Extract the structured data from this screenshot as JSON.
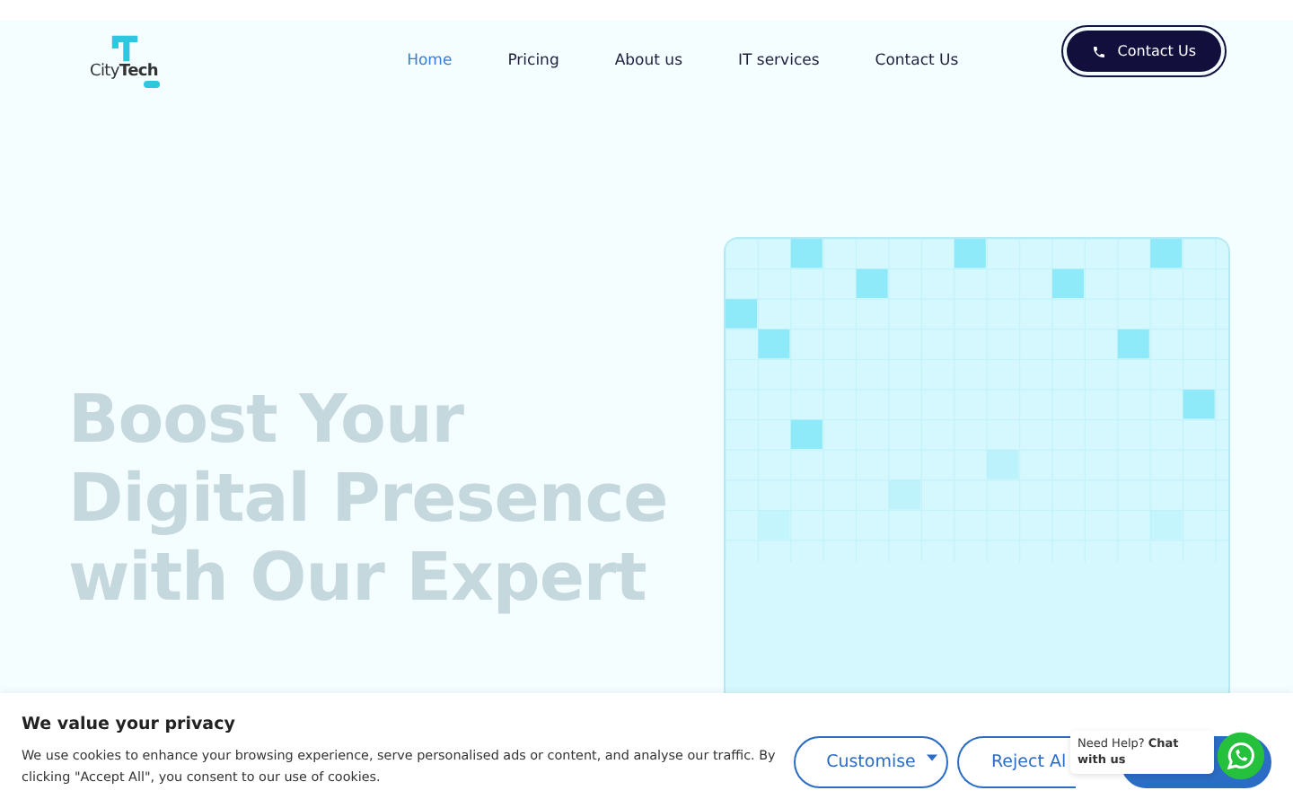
{
  "logo": {
    "text": "City**Tech**"
  },
  "nav": [
    {
      "label": "Home",
      "selected": true
    },
    {
      "label": "Pricing",
      "selected": false
    },
    {
      "label": "About us",
      "selected": false
    },
    {
      "label": "IT services",
      "selected": false
    },
    {
      "label": "Contact Us",
      "selected": false
    }
  ],
  "contact_button": "Contact Us",
  "hero": {
    "headline": [
      "Boost Your",
      "Digital Presence",
      "with Our Expert"
    ]
  },
  "cookie_banner": {
    "title": "We value your privacy",
    "text": "We use cookies to enhance your browsing experience, serve personalised ads or content, and analyse our traffic. By clicking \"Accept All\", you consent to our use of cookies.",
    "customise": "Customise",
    "reject": "Reject Al"
  },
  "chat": {
    "text": "Need Help? **Chat with us**"
  }
}
